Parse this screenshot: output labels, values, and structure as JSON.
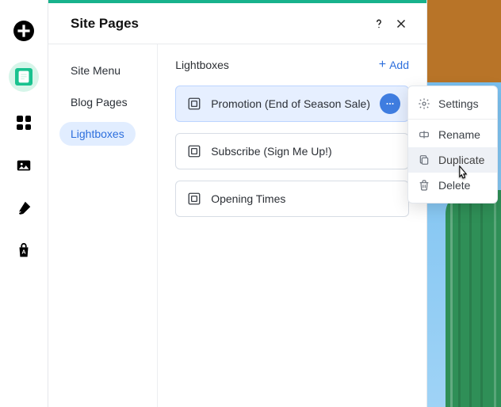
{
  "panel": {
    "title": "Site Pages"
  },
  "sidebar": {
    "items": [
      {
        "label": "Site Menu"
      },
      {
        "label": "Blog Pages"
      },
      {
        "label": "Lightboxes"
      }
    ]
  },
  "section": {
    "title": "Lightboxes",
    "add_label": "Add"
  },
  "rows": [
    {
      "label": "Promotion (End of Season Sale)"
    },
    {
      "label": "Subscribe (Sign Me Up!)"
    },
    {
      "label": "Opening Times"
    }
  ],
  "menu": {
    "items": [
      {
        "key": "settings",
        "label": "Settings"
      },
      {
        "key": "rename",
        "label": "Rename"
      },
      {
        "key": "duplicate",
        "label": "Duplicate"
      },
      {
        "key": "delete",
        "label": "Delete"
      }
    ]
  }
}
